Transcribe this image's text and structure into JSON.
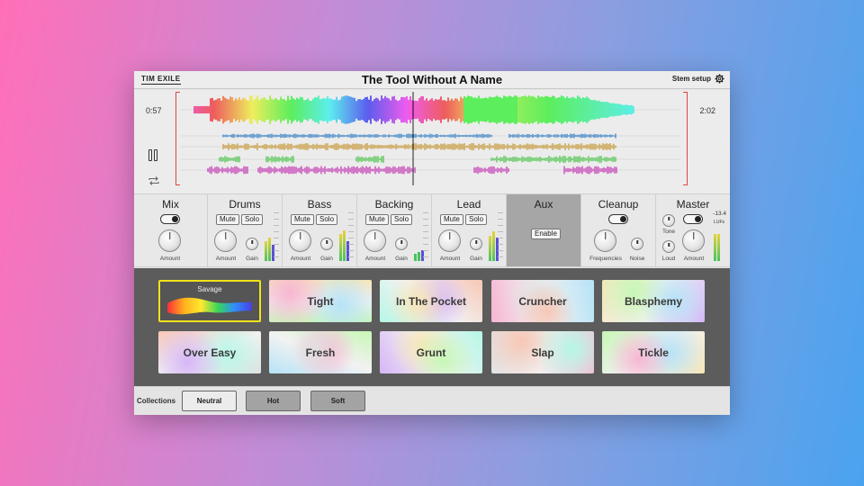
{
  "app": {
    "brand": "TIM EXILE",
    "title": "The Tool Without A Name",
    "stem_setup": "Stem setup"
  },
  "transport": {
    "time_start": "0:57",
    "time_end": "2:02"
  },
  "mixer": {
    "mix": {
      "name": "Mix",
      "amount_label": "Amount"
    },
    "drums": {
      "name": "Drums",
      "mute": "Mute",
      "solo": "Solo",
      "amount_label": "Amount",
      "gain_label": "Gain"
    },
    "bass": {
      "name": "Bass",
      "mute": "Mute",
      "solo": "Solo",
      "amount_label": "Amount",
      "gain_label": "Gain"
    },
    "backing": {
      "name": "Backing",
      "mute": "Mute",
      "solo": "Solo",
      "amount_label": "Amount",
      "gain_label": "Gain"
    },
    "lead": {
      "name": "Lead",
      "mute": "Mute",
      "solo": "Solo",
      "amount_label": "Amount",
      "gain_label": "Gain"
    },
    "aux": {
      "name": "Aux",
      "enable": "Enable"
    },
    "cleanup": {
      "name": "Cleanup",
      "frequencies_label": "Frequencies",
      "noise_label": "Noise"
    },
    "master": {
      "name": "Master",
      "tone_label": "Tone",
      "loud_label": "Loud",
      "amount_label": "Amount",
      "lufs_value": "-13.4",
      "lufs_unit": "LUFs"
    }
  },
  "presets": {
    "selected": {
      "label": "Savage"
    },
    "items": [
      {
        "label": "Tight"
      },
      {
        "label": "In The Pocket"
      },
      {
        "label": "Cruncher"
      },
      {
        "label": "Blasphemy"
      },
      {
        "label": "Over Easy"
      },
      {
        "label": "Fresh"
      },
      {
        "label": "Grunt"
      },
      {
        "label": "Slap"
      },
      {
        "label": "Tickle"
      }
    ]
  },
  "collections": {
    "label": "Collections",
    "buttons": [
      {
        "label": "Neutral"
      },
      {
        "label": "Hot"
      },
      {
        "label": "Soft"
      }
    ]
  },
  "colors": {
    "drums_wave": "#3f86c8",
    "bass_wave": "#c9a046",
    "backing_wave": "#5ac85a",
    "lead_wave": "#c84ab8",
    "playhead": "#222222",
    "selection": "#f2e21a"
  }
}
